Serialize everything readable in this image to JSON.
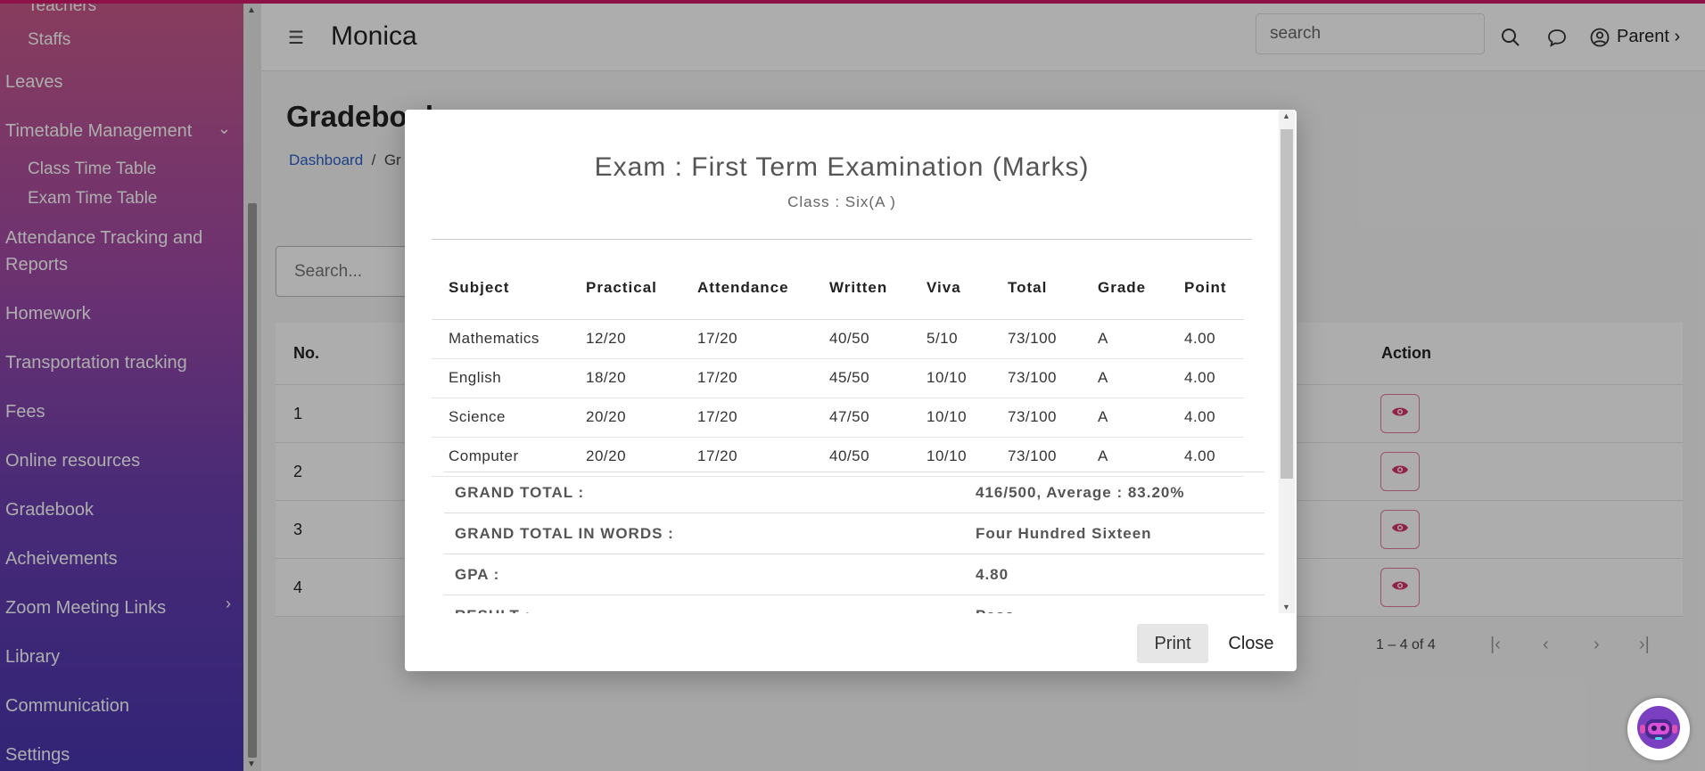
{
  "app": {
    "brand": "Monica",
    "user_menu": "Parent"
  },
  "header": {
    "search_placeholder": "search"
  },
  "sidebar": {
    "items": [
      {
        "label": "Teachers"
      },
      {
        "label": "Staffs"
      },
      {
        "label": "Leaves"
      },
      {
        "label": "Timetable Management"
      },
      {
        "label": "Class Time Table"
      },
      {
        "label": "Exam Time Table"
      },
      {
        "label": "Attendance Tracking and"
      },
      {
        "label": "Reports"
      },
      {
        "label": "Homework"
      },
      {
        "label": "Transportation tracking"
      },
      {
        "label": "Fees"
      },
      {
        "label": "Online resources"
      },
      {
        "label": "Gradebook"
      },
      {
        "label": "Acheivements"
      },
      {
        "label": "Zoom Meeting Links"
      },
      {
        "label": "Library"
      },
      {
        "label": "Communication"
      },
      {
        "label": "Settings"
      }
    ]
  },
  "page": {
    "title": "Gradebook",
    "breadcrumb": {
      "home": "Dashboard",
      "separator": "/",
      "current": "Gr"
    },
    "search_placeholder": "Search...",
    "table": {
      "col_no": "No.",
      "col_action": "Action",
      "rows": [
        "1",
        "2",
        "3",
        "4"
      ]
    },
    "pagination": "1 – 4 of 4"
  },
  "modal": {
    "exam_title": "Exam : First Term Examination (Marks)",
    "class_title": "Class : Six(A )",
    "columns": [
      "Subject",
      "Practical",
      "Attendance",
      "Written",
      "Viva",
      "Total",
      "Grade",
      "Point"
    ],
    "rows": [
      [
        "Mathematics",
        "12/20",
        "17/20",
        "40/50",
        "5/10",
        "73/100",
        "A",
        "4.00"
      ],
      [
        "English",
        "18/20",
        "17/20",
        "45/50",
        "10/10",
        "73/100",
        "A",
        "4.00"
      ],
      [
        "Science",
        "20/20",
        "17/20",
        "47/50",
        "10/10",
        "73/100",
        "A",
        "4.00"
      ],
      [
        "Computer",
        "20/20",
        "17/20",
        "40/50",
        "10/10",
        "73/100",
        "A",
        "4.00"
      ]
    ],
    "summary": [
      {
        "label": "GRAND TOTAL :",
        "value": "416/500, Average : 83.20%"
      },
      {
        "label": "GRAND TOTAL IN WORDS :",
        "value": "Four Hundred Sixteen"
      },
      {
        "label": "GPA :",
        "value": "4.80"
      },
      {
        "label": "RESULT :",
        "value": "Pass"
      }
    ],
    "print_label": "Print",
    "close_label": "Close"
  },
  "colors": {
    "accent": "#d11b6b",
    "link": "#2b5fc9",
    "eye": "#d6336c"
  }
}
